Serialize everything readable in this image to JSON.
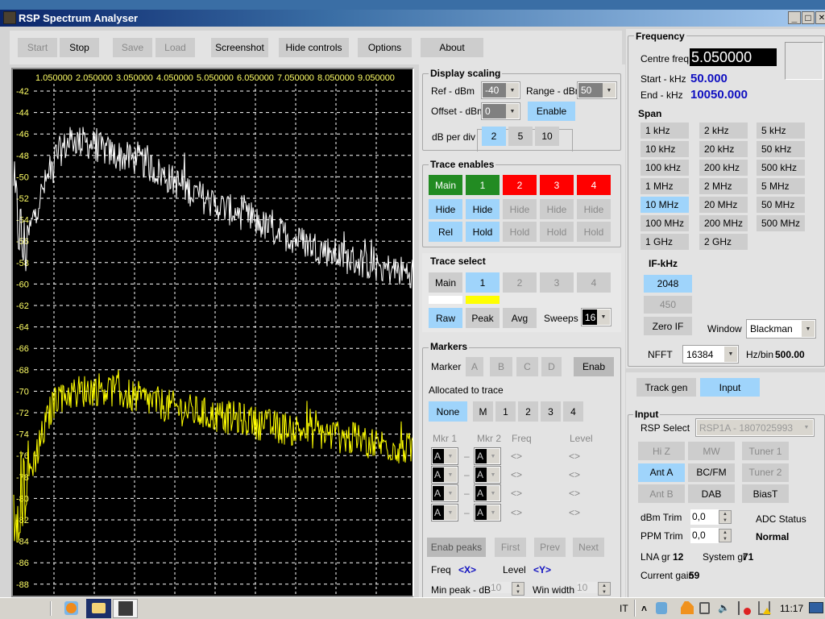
{
  "window": {
    "title": "RSP Spectrum Analyser",
    "minimize": "_",
    "maximize": "□",
    "close": "✕"
  },
  "toolbar": {
    "start": "Start",
    "stop": "Stop",
    "save": "Save",
    "load": "Load",
    "screenshot": "Screenshot",
    "hide_controls": "Hide controls",
    "options": "Options",
    "about": "About"
  },
  "spectrum": {
    "x_tick_labels": [
      "1.050000",
      "2.050000",
      "3.050000",
      "4.050000",
      "5.050000",
      "6.050000",
      "7.050000",
      "8.050000",
      "9.050000"
    ],
    "y_tick_labels": [
      "-42",
      "-44",
      "-46",
      "-48",
      "-50",
      "-52",
      "-54",
      "-56",
      "-58",
      "-60",
      "-62",
      "-64",
      "-66",
      "-68",
      "-70",
      "-72",
      "-74",
      "-76",
      "-78",
      "-80",
      "-82",
      "-84",
      "-86",
      "-88"
    ],
    "x_range_mhz": [
      0.05,
      10.05
    ],
    "y_range_dbm": [
      -42,
      -88
    ],
    "colors": {
      "background": "#000000",
      "grid": "#ffffff",
      "labels": "#ffff66",
      "main": "#ffffff",
      "trace1": "#ffff00"
    },
    "main_trace_envelope": [
      [
        0.05,
        -52
      ],
      [
        0.3,
        -57
      ],
      [
        0.6,
        -53
      ],
      [
        0.9,
        -50
      ],
      [
        1.1,
        -48
      ],
      [
        1.5,
        -46.5
      ],
      [
        2.0,
        -47
      ],
      [
        2.6,
        -48
      ],
      [
        3.2,
        -48.5
      ],
      [
        3.7,
        -49.7
      ],
      [
        4.3,
        -51
      ],
      [
        5.0,
        -52.5
      ],
      [
        5.7,
        -53.5
      ],
      [
        6.5,
        -55
      ],
      [
        7.2,
        -56
      ],
      [
        8.3,
        -57.6
      ],
      [
        9.2,
        -58.5
      ],
      [
        10.0,
        -59
      ]
    ],
    "trace1_envelope": [
      [
        0.05,
        -81
      ],
      [
        0.3,
        -79
      ],
      [
        0.6,
        -76
      ],
      [
        0.9,
        -72.5
      ],
      [
        1.1,
        -70.5
      ],
      [
        1.7,
        -70
      ],
      [
        2.3,
        -69.7
      ],
      [
        3.0,
        -70.5
      ],
      [
        4.0,
        -71.5
      ],
      [
        5.0,
        -72.3
      ],
      [
        5.7,
        -72.6
      ],
      [
        6.5,
        -73.3
      ],
      [
        7.5,
        -73.8
      ],
      [
        8.5,
        -74.5
      ],
      [
        10.0,
        -75.5
      ]
    ]
  },
  "display_scaling": {
    "title": "Display scaling",
    "ref_label": "Ref - dBm",
    "ref_value": "-40",
    "range_label": "Range - dBm",
    "range_value": "50",
    "offset_label": "Offset - dBm",
    "offset_value": "0",
    "enable": "Enable",
    "db_per_div_label": "dB per div",
    "db_per_div": [
      "2",
      "5",
      "10"
    ],
    "db_per_div_selected": "2"
  },
  "trace_enables": {
    "title": "Trace enables",
    "traces": [
      "Main",
      "1",
      "2",
      "3",
      "4"
    ],
    "hide": [
      "Hide",
      "Hide",
      "Hide",
      "Hide",
      "Hide"
    ],
    "mode": [
      "Rel",
      "Hold",
      "Hold",
      "Hold",
      "Hold"
    ],
    "colors": {
      "enabled": "#228b22",
      "disabled": "#ff0000"
    }
  },
  "trace_select": {
    "title": "Trace select",
    "traces": [
      "Main",
      "1",
      "2",
      "3",
      "4"
    ],
    "selected": "1",
    "modes": [
      "Raw",
      "Peak",
      "Avg"
    ],
    "mode_selected": "Raw",
    "sweeps_label": "Sweeps",
    "sweeps_value": "16"
  },
  "markers": {
    "title": "Markers",
    "marker_label": "Marker",
    "markers": [
      "A",
      "B",
      "C",
      "D"
    ],
    "enab": "Enab",
    "allocated_label": "Allocated to trace",
    "allocated": [
      "None",
      "M",
      "1",
      "2",
      "3",
      "4"
    ],
    "allocated_selected": "None",
    "columns": [
      "Mkr 1",
      "Mkr 2",
      "Freq",
      "Level"
    ],
    "rows": [
      {
        "m1": "A",
        "m2": "A",
        "freq": "<>",
        "level": "<>"
      },
      {
        "m1": "A",
        "m2": "A",
        "freq": "<>",
        "level": "<>"
      },
      {
        "m1": "A",
        "m2": "A",
        "freq": "<>",
        "level": "<>"
      },
      {
        "m1": "A",
        "m2": "A",
        "freq": "<>",
        "level": "<>"
      }
    ],
    "dash": "–",
    "enab_peaks": "Enab peaks",
    "first": "First",
    "prev": "Prev",
    "next": "Next",
    "freq_label": "Freq",
    "freq_value": "<X>",
    "level_label": "Level",
    "level_value": "<Y>",
    "min_peak_label": "Min peak - dB",
    "min_peak_value": "10",
    "win_width_label": "Win width",
    "win_width_value": "10"
  },
  "frequency": {
    "title": "Frequency",
    "centre_label": "Centre freq",
    "centre_value": "5.050000",
    "start_label": "Start - kHz",
    "start_value": "50.000",
    "end_label": "End - kHz",
    "end_value": "10050.000",
    "span_label": "Span",
    "spans": [
      "1 kHz",
      "2 kHz",
      "5 kHz",
      "10 kHz",
      "20 kHz",
      "50 kHz",
      "100 kHz",
      "200 kHz",
      "500 kHz",
      "1 MHz",
      "2 MHz",
      "5 MHz",
      "10 MHz",
      "20 MHz",
      "50 MHz",
      "100 MHz",
      "200 MHz",
      "500 MHz",
      "1 GHz",
      "2 GHz"
    ],
    "span_selected": "10 MHz",
    "if_label": "IF-kHz",
    "if_options": [
      "2048",
      "450",
      "Zero IF"
    ],
    "if_selected": "2048",
    "window_label": "Window",
    "window_value": "Blackman",
    "nfft_label": "NFFT",
    "nfft_value": "16384",
    "hzbin_label": "Hz/bin",
    "hzbin_value": "500.00"
  },
  "tabs": {
    "track_gen": "Track gen",
    "input": "Input",
    "selected": "Input"
  },
  "input": {
    "title": "Input",
    "rsp_label": "RSP Select",
    "rsp_value": "RSP1A - 1807025993",
    "buttons": [
      "Hi Z",
      "MW",
      "Tuner 1",
      "Ant A",
      "BC/FM",
      "Tuner 2",
      "Ant B",
      "DAB",
      "BiasT"
    ],
    "selected": "Ant A",
    "dbm_trim_label": "dBm Trim",
    "dbm_trim_value": "0,0",
    "ppm_trim_label": "PPM Trim",
    "ppm_trim_value": "0,0",
    "adc_label": "ADC Status",
    "adc_value": "Normal",
    "lna_label": "LNA gr",
    "lna_value": "12",
    "system_label": "System gr",
    "system_value": "71",
    "current_label": "Current gain",
    "current_value": "59"
  },
  "taskbar": {
    "language": "IT",
    "clock": "11:17",
    "tray_expand": "˄",
    "icons": [
      "media-player-icon",
      "file-explorer-icon",
      "rsp-app-icon"
    ]
  },
  "colors": {
    "accent": "#9fd4fb",
    "button": "#cdcdcd",
    "panel": "#e3e3e3"
  }
}
